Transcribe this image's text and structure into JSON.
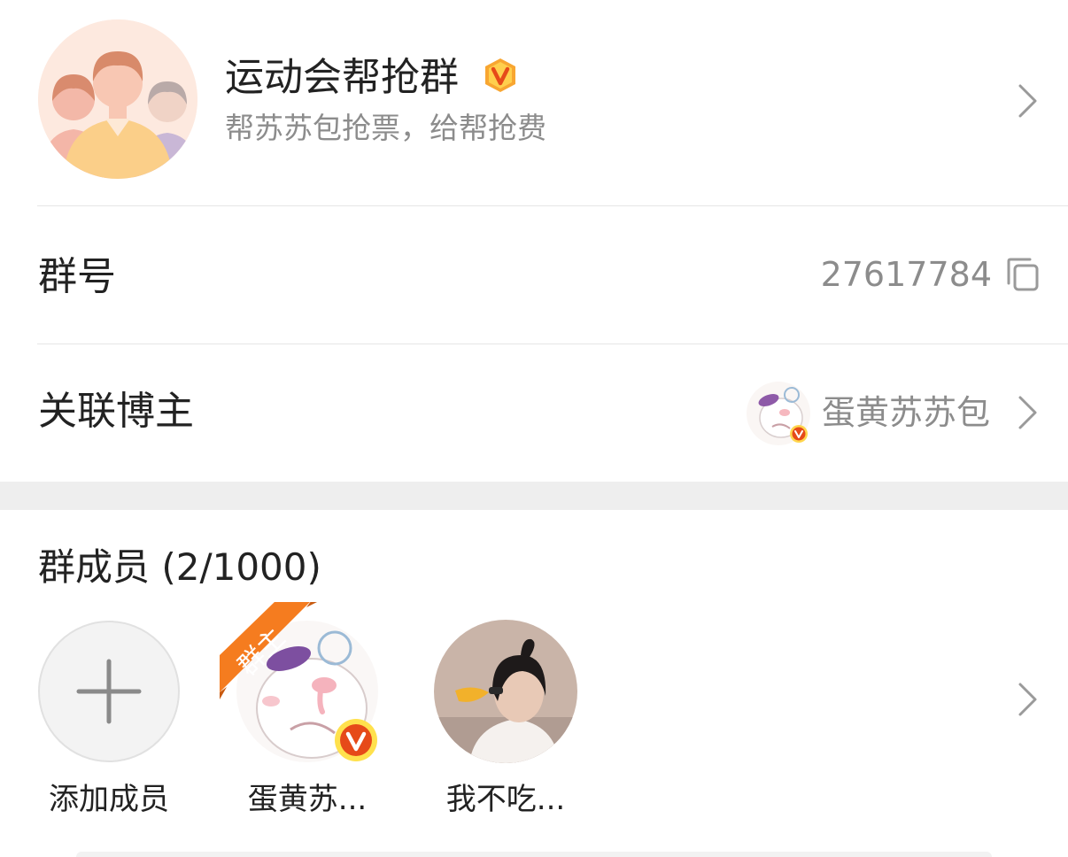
{
  "group": {
    "name": "运动会帮抢群",
    "description": "帮苏苏包抢票，给帮抢费",
    "badge_icon": "vip-v-badge-icon"
  },
  "group_number": {
    "label": "群号",
    "value": "27617784",
    "icon": "copy-icon"
  },
  "linked_blogger": {
    "label": "关联博主",
    "name": "蛋黄苏苏包",
    "icon": "chevron-right-icon"
  },
  "members": {
    "title": "群成员 (2/1000)",
    "list": [
      {
        "name": "添加成员",
        "type": "add"
      },
      {
        "name": "蛋黄苏...",
        "role": "群主",
        "verified": true
      },
      {
        "name": "我不吃...",
        "verified": false
      }
    ]
  },
  "colors": {
    "accent_orange": "#f57c1f",
    "badge_red": "#e64a19",
    "secondary_text": "#8c8c8c",
    "divider": "#e6e6e6"
  }
}
